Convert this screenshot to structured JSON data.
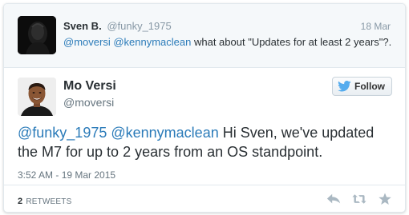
{
  "parent_tweet": {
    "name": "Sven B.",
    "handle": "@funky_1975",
    "date": "18 Mar",
    "mentions": [
      "@moversi",
      "@kennymaclean"
    ],
    "text": "what about \"Updates for at least 2 years\"?."
  },
  "main_tweet": {
    "name": "Mo Versi",
    "handle": "@moversi",
    "follow_label": "Follow",
    "mentions": [
      "@funky_1975",
      "@kennymaclean"
    ],
    "text_line1": "Hi Sven, we've updated",
    "text_line2": "the M7 for up to 2 years from an OS standpoint.",
    "timestamp": "3:52 AM - 19 Mar 2015"
  },
  "footer": {
    "retweet_count": "2",
    "retweet_label": "RETWEETS",
    "actions": [
      "reply-icon",
      "retweet-icon",
      "favorite-icon"
    ]
  },
  "colors": {
    "link": "#2b7bb9",
    "twitter_blue": "#55acee",
    "action_gray": "#aab8c2"
  }
}
